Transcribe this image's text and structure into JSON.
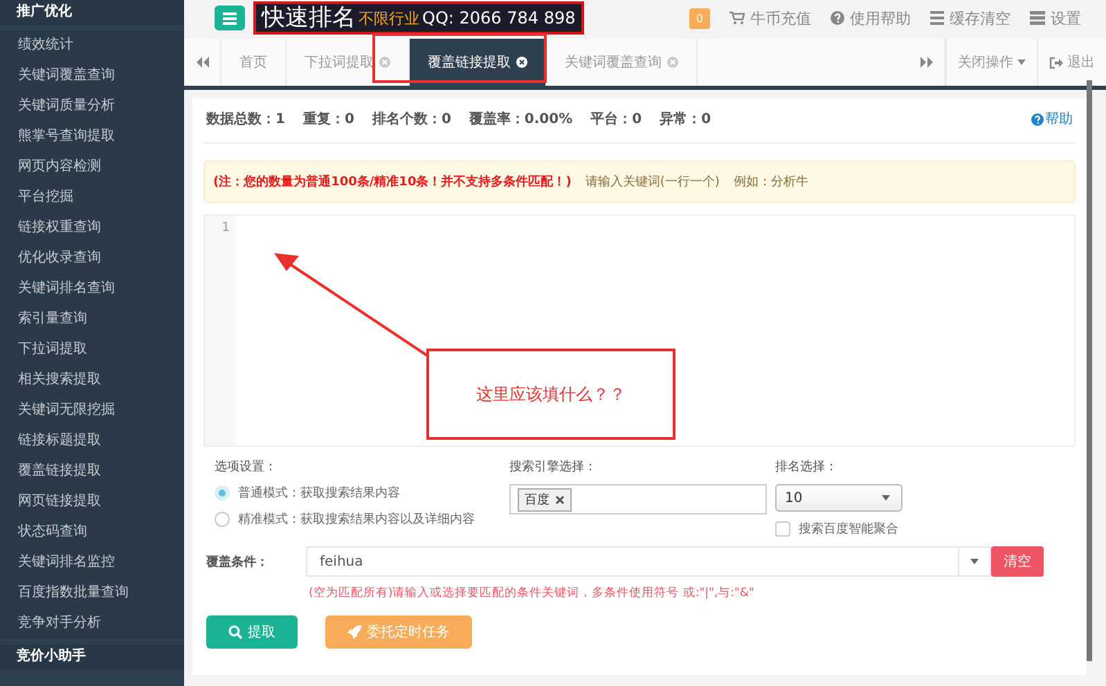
{
  "sidebar": {
    "groups": [
      {
        "title": "推广优化",
        "items": [
          "绩效统计",
          "关键词覆盖查询",
          "关键词质量分析",
          "熊掌号查询提取",
          "网页内容检测",
          "平台挖掘",
          "链接权重查询",
          "优化收录查询",
          "关键词排名查询",
          "索引量查询",
          "下拉词提取",
          "相关搜索提取",
          "关键词无限挖掘",
          "链接标题提取",
          "覆盖链接提取",
          "网页链接提取",
          "状态码查询",
          "关键词排名监控",
          "百度指数批量查询",
          "竞争对手分析"
        ]
      },
      {
        "title": "竞价小助手"
      }
    ]
  },
  "header": {
    "logo": {
      "title": "快速排名",
      "tag": "不限行业",
      "qq": "QQ: 2066 784 898"
    },
    "badge": "0",
    "links": [
      {
        "label": "牛币充值",
        "kind": "cart"
      },
      {
        "label": "使用帮助",
        "kind": "help"
      },
      {
        "label": "缓存清空",
        "kind": "list"
      },
      {
        "label": "设置",
        "kind": "bars"
      }
    ]
  },
  "tabs": [
    {
      "label": "首页",
      "closable": false,
      "selected": false
    },
    {
      "label": "下拉词提取",
      "closable": true,
      "selected": false
    },
    {
      "label": "覆盖链接提取",
      "closable": true,
      "selected": true
    },
    {
      "label": "关键词覆盖查询",
      "closable": true,
      "selected": false
    }
  ],
  "tab_actions": {
    "close_menu": "关闭操作",
    "logout": "退出"
  },
  "stats": [
    "数据总数：1",
    "重复：0",
    "排名个数：0",
    "覆盖率：0.00%",
    "平台：0",
    "异常：0"
  ],
  "help": "帮助",
  "notice": {
    "warning": "(注：您的数量为普通100条/精准10条！并不支持多条件匹配！)",
    "hint": "请输入关键词(一行一个)",
    "example": "例如：分析牛"
  },
  "editor": {
    "line_numbers": [
      "1"
    ]
  },
  "annotation": {
    "text": "这里应该填什么？？"
  },
  "options": {
    "title": "选项设置：",
    "modes": [
      {
        "label": "普通模式：获取搜索结果内容",
        "selected": true
      },
      {
        "label": "精准模式：获取搜索结果内容以及详细内容",
        "selected": false
      }
    ]
  },
  "engine": {
    "title": "搜索引擎选择：",
    "tags": [
      "百度"
    ]
  },
  "ranking": {
    "title": "排名选择：",
    "value": "10",
    "aggregate": {
      "label": "搜索百度智能聚合",
      "checked": false
    }
  },
  "condition": {
    "label": "覆盖条件：",
    "value": "feihua",
    "clear": "清空",
    "hint": "(空为匹配所有)请输入或选择要匹配的条件关键词，多条件使用符号 或:\"|\",与:\"&\""
  },
  "buttons": [
    {
      "label": "提取",
      "kind": "primary"
    },
    {
      "label": "委托定时任务",
      "kind": "schedule"
    }
  ]
}
